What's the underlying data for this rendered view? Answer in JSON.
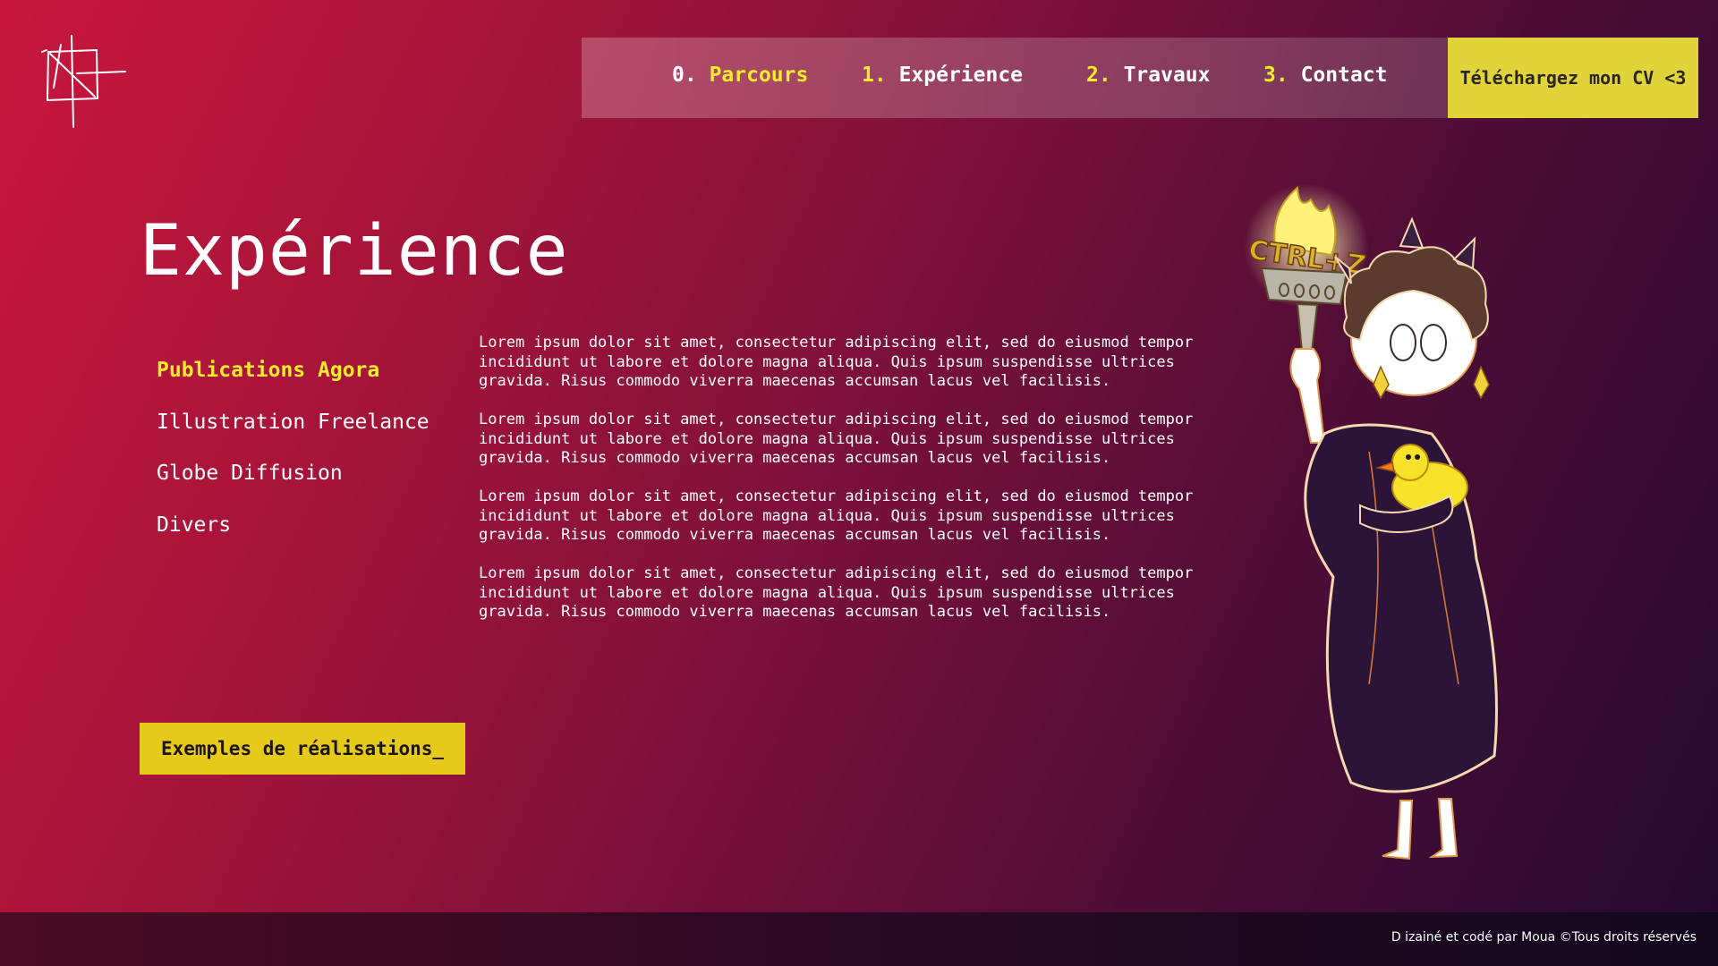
{
  "logo": {
    "icon": "crossed-square-logo-icon"
  },
  "nav": {
    "items": [
      {
        "num": "0.",
        "label": "Parcours"
      },
      {
        "num": "1.",
        "label": "Expérience"
      },
      {
        "num": "2.",
        "label": "Travaux"
      },
      {
        "num": "3.",
        "label": "Contact"
      }
    ],
    "cv_label": "Téléchargez mon CV <3"
  },
  "page": {
    "title": "Expérience"
  },
  "side_menu": {
    "items": [
      {
        "label": "Publications Agora",
        "active": true
      },
      {
        "label": "Illustration Freelance",
        "active": false
      },
      {
        "label": "Globe Diffusion",
        "active": false
      },
      {
        "label": "Divers",
        "active": false
      }
    ]
  },
  "content": {
    "paragraphs": [
      "Lorem ipsum dolor sit amet, consectetur adipiscing elit, sed do eiusmod tempor incididunt ut labore et dolore magna aliqua. Quis ipsum suspendisse ultrices gravida. Risus commodo viverra maecenas accumsan lacus vel facilisis.",
      "Lorem ipsum dolor sit amet, consectetur adipiscing elit, sed do eiusmod tempor incididunt ut labore et dolore magna aliqua. Quis ipsum suspendisse ultrices gravida. Risus commodo viverra maecenas accumsan lacus vel facilisis.",
      "Lorem ipsum dolor sit amet, consectetur adipiscing elit, sed do eiusmod tempor incididunt ut labore et dolore magna aliqua. Quis ipsum suspendisse ultrices gravida. Risus commodo viverra maecenas accumsan lacus vel facilisis.",
      "Lorem ipsum dolor sit amet, consectetur adipiscing elit, sed do eiusmod tempor incididunt ut labore et dolore magna aliqua. Quis ipsum suspendisse ultrices gravida. Risus commodo viverra maecenas accumsan lacus vel facilisis."
    ],
    "examples_button": "Exemples de réalisations_"
  },
  "illustration": {
    "torch_text": "CTRL+Z"
  },
  "footer": {
    "text": "D izainé et codé par Moua ©Tous droits réservés"
  },
  "colors": {
    "accent_yellow": "#f6ec2d",
    "cv_button": "#e1d43a",
    "examples_button": "#e6ca1a",
    "bg_start": "#c8173c",
    "bg_end": "#230a30"
  }
}
